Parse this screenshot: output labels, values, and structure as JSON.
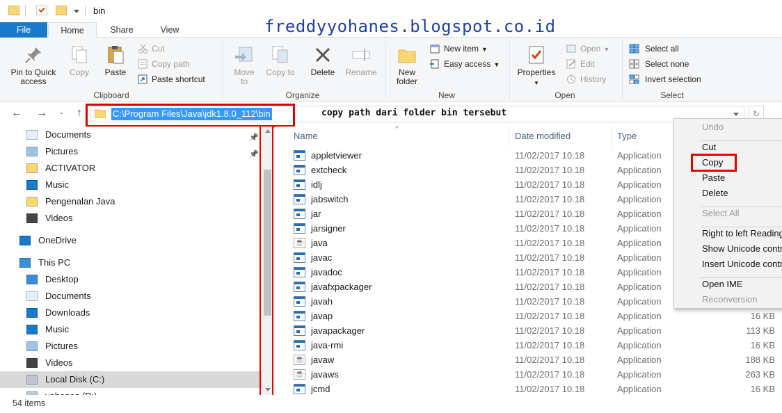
{
  "window": {
    "title": "bin",
    "quick_access_icons": [
      "folder-icon",
      "properties-check-icon",
      "new-folder-icon"
    ]
  },
  "watermark": "freddyyohanes.blogspot.co.id",
  "tabs": [
    "File",
    "Home",
    "Share",
    "View"
  ],
  "ribbon": {
    "clipboard": {
      "label": "Clipboard",
      "pin_to_quick_access": "Pin to Quick access",
      "copy": "Copy",
      "paste": "Paste",
      "cut": "Cut",
      "copy_path": "Copy path",
      "paste_shortcut": "Paste shortcut"
    },
    "organize": {
      "label": "Organize",
      "move_to": "Move to",
      "copy_to": "Copy to",
      "delete": "Delete",
      "rename": "Rename"
    },
    "new": {
      "label": "New",
      "new_folder": "New folder",
      "new_item": "New item",
      "easy_access": "Easy access"
    },
    "open": {
      "label": "Open",
      "properties": "Properties",
      "open": "Open",
      "edit": "Edit",
      "history": "History"
    },
    "select": {
      "label": "Select",
      "select_all": "Select all",
      "select_none": "Select none",
      "invert_selection": "Invert selection"
    }
  },
  "address_bar": {
    "path": "C:\\Program Files\\Java\\jdk1.8.0_112\\bin",
    "annotation": "copy path dari folder bin tersebut"
  },
  "nav_pane": {
    "items": [
      {
        "label": "Documents",
        "icon": "documents-icon",
        "pinned": true
      },
      {
        "label": "Pictures",
        "icon": "pictures-icon",
        "pinned": true
      },
      {
        "label": "ACTIVATOR",
        "icon": "folder-icon",
        "pinned": false
      },
      {
        "label": "Music",
        "icon": "music-icon",
        "pinned": false
      },
      {
        "label": "Pengenalan Java",
        "icon": "folder-icon",
        "pinned": false
      },
      {
        "label": "Videos",
        "icon": "videos-icon",
        "pinned": false
      },
      {
        "label": "OneDrive",
        "icon": "onedrive-icon",
        "pinned": false
      },
      {
        "label": "This PC",
        "icon": "this-pc-icon",
        "pinned": false
      },
      {
        "label": "Desktop",
        "icon": "desktop-icon",
        "pinned": false
      },
      {
        "label": "Documents",
        "icon": "documents-icon",
        "pinned": false
      },
      {
        "label": "Downloads",
        "icon": "downloads-icon",
        "pinned": false
      },
      {
        "label": "Music",
        "icon": "music-icon",
        "pinned": false
      },
      {
        "label": "Pictures",
        "icon": "pictures-icon",
        "pinned": false
      },
      {
        "label": "Videos",
        "icon": "videos-icon",
        "pinned": false
      },
      {
        "label": "Local Disk (C:)",
        "icon": "local-disk-icon",
        "pinned": false,
        "selected": true
      },
      {
        "label": "yohanes (D:)",
        "icon": "drive-icon",
        "pinned": false
      }
    ]
  },
  "file_list": {
    "columns": [
      "Name",
      "Date modified",
      "Type",
      "Size"
    ],
    "rows": [
      {
        "name": "appletviewer",
        "date": "11/02/2017 10.18",
        "type": "Application",
        "size": "",
        "icon": "exe"
      },
      {
        "name": "extcheck",
        "date": "11/02/2017 10.18",
        "type": "Application",
        "size": "",
        "icon": "exe"
      },
      {
        "name": "idlj",
        "date": "11/02/2017 10.18",
        "type": "Application",
        "size": "",
        "icon": "exe"
      },
      {
        "name": "jabswitch",
        "date": "11/02/2017 10.18",
        "type": "Application",
        "size": "",
        "icon": "exe"
      },
      {
        "name": "jar",
        "date": "11/02/2017 10.18",
        "type": "Application",
        "size": "",
        "icon": "exe"
      },
      {
        "name": "jarsigner",
        "date": "11/02/2017 10.18",
        "type": "Application",
        "size": "",
        "icon": "exe"
      },
      {
        "name": "java",
        "date": "11/02/2017 10.18",
        "type": "Application",
        "size": "",
        "icon": "java"
      },
      {
        "name": "javac",
        "date": "11/02/2017 10.18",
        "type": "Application",
        "size": "",
        "icon": "exe"
      },
      {
        "name": "javadoc",
        "date": "11/02/2017 10.18",
        "type": "Application",
        "size": "",
        "icon": "exe"
      },
      {
        "name": "javafxpackager",
        "date": "11/02/2017 10.18",
        "type": "Application",
        "size": "",
        "icon": "exe"
      },
      {
        "name": "javah",
        "date": "11/02/2017 10.18",
        "type": "Application",
        "size": "",
        "icon": "exe"
      },
      {
        "name": "javap",
        "date": "11/02/2017 10.18",
        "type": "Application",
        "size": "16 KB",
        "icon": "exe"
      },
      {
        "name": "javapackager",
        "date": "11/02/2017 10.18",
        "type": "Application",
        "size": "113 KB",
        "icon": "exe"
      },
      {
        "name": "java-rmi",
        "date": "11/02/2017 10.18",
        "type": "Application",
        "size": "16 KB",
        "icon": "exe"
      },
      {
        "name": "javaw",
        "date": "11/02/2017 10.18",
        "type": "Application",
        "size": "188 KB",
        "icon": "java"
      },
      {
        "name": "javaws",
        "date": "11/02/2017 10.18",
        "type": "Application",
        "size": "263 KB",
        "icon": "java"
      },
      {
        "name": "jcmd",
        "date": "11/02/2017 10.18",
        "type": "Application",
        "size": "16 KB",
        "icon": "exe"
      }
    ]
  },
  "status": {
    "item_count": "54 items"
  },
  "context_menu": {
    "items": [
      {
        "label": "Undo",
        "disabled": true
      },
      {
        "sep": true
      },
      {
        "label": "Cut",
        "disabled": false
      },
      {
        "label": "Copy",
        "disabled": false,
        "highlighted": true
      },
      {
        "label": "Paste",
        "disabled": false
      },
      {
        "label": "Delete",
        "disabled": false
      },
      {
        "sep": true
      },
      {
        "label": "Select All",
        "disabled": true
      },
      {
        "sep": true
      },
      {
        "label": "Right to left Reading order",
        "disabled": false
      },
      {
        "label": "Show Unicode control characters",
        "disabled": false
      },
      {
        "label": "Insert Unicode control character",
        "disabled": false
      },
      {
        "sep": true
      },
      {
        "label": "Open IME",
        "disabled": false
      },
      {
        "label": "Reconversion",
        "disabled": true
      }
    ]
  },
  "colors": {
    "file_tab": "#1979ca",
    "selection": "#3399ff",
    "annotation_red": "#e00000",
    "watermark": "#1f3fa6"
  }
}
